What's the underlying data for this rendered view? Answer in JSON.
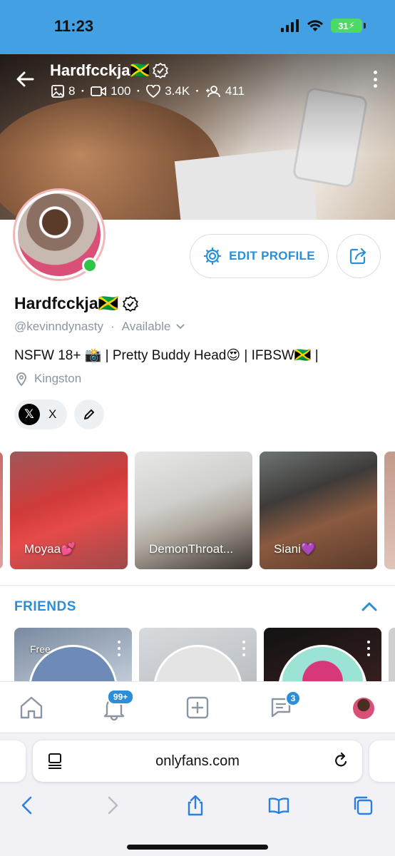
{
  "status_bar": {
    "time": "11:23",
    "battery": "31"
  },
  "header": {
    "name": "Hardfcckja🇯🇲",
    "stats": {
      "images": "8",
      "videos": "100",
      "likes": "3.4K",
      "fans": "411"
    }
  },
  "profile": {
    "edit_label": "EDIT PROFILE",
    "name": "Hardfcckja🇯🇲",
    "handle": "@kevinndynasty",
    "separator": "·",
    "availability": "Available",
    "bio": "NSFW 18+ 📸 | Pretty Buddy Head😍 | IFBSW🇯🇲 |",
    "location": "Kingston",
    "social_x": "X"
  },
  "stories": [
    {
      "label": "Moyaa💕"
    },
    {
      "label": "DemonThroat..."
    },
    {
      "label": "Siani💜"
    }
  ],
  "friends": {
    "title": "FRIENDS",
    "cards": [
      {
        "tag": "Free"
      }
    ]
  },
  "tabbar": {
    "notifications_badge": "99+",
    "messages_badge": "3"
  },
  "browser": {
    "url": "onlyfans.com"
  },
  "colors": {
    "accent": "#2a8fd8",
    "status_bar": "#43a1e3",
    "online": "#2ec445"
  }
}
